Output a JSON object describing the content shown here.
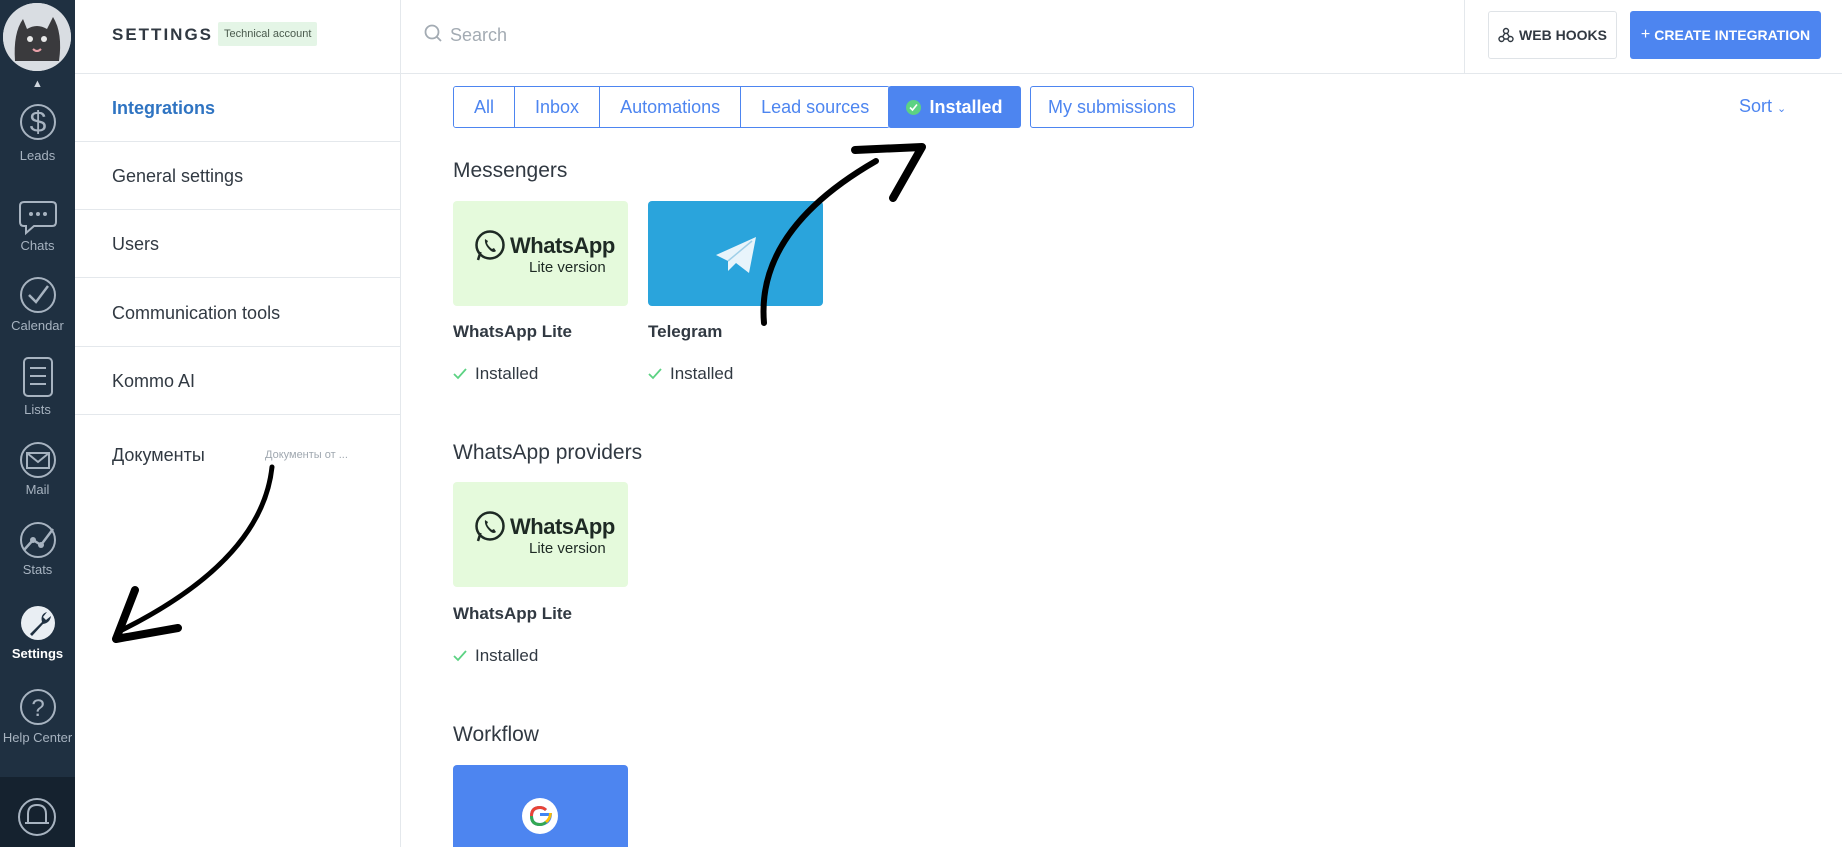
{
  "rail": {
    "items": [
      {
        "label": "Leads",
        "icon": "dollar-icon"
      },
      {
        "label": "Chats",
        "icon": "chat-bubble-icon"
      },
      {
        "label": "Calendar",
        "icon": "check-circle-icon"
      },
      {
        "label": "Lists",
        "icon": "list-icon"
      },
      {
        "label": "Mail",
        "icon": "mail-icon"
      },
      {
        "label": "Stats",
        "icon": "stats-icon"
      },
      {
        "label": "Settings",
        "icon": "wrench-icon",
        "active": true
      },
      {
        "label": "Help Center",
        "icon": "question-icon"
      }
    ]
  },
  "menu": {
    "title": "SETTINGS",
    "account_badge": "Technical account",
    "items": [
      {
        "label": "Integrations",
        "active": true
      },
      {
        "label": "General settings"
      },
      {
        "label": "Users"
      },
      {
        "label": "Communication tools"
      },
      {
        "label": "Kommo AI"
      },
      {
        "label": "Документы",
        "sub": "Документы от ..."
      }
    ]
  },
  "topbar": {
    "search_placeholder": "Search",
    "webhooks_label": "WEB HOOKS",
    "create_label": "CREATE INTEGRATION",
    "create_prefix": "+"
  },
  "filters": {
    "tabs": [
      "All",
      "Inbox",
      "Automations",
      "Lead sources"
    ],
    "installed": "Installed",
    "submissions": "My submissions",
    "sort": "Sort"
  },
  "sections": [
    {
      "title": "Messengers",
      "cards": [
        {
          "name": "WhatsApp Lite",
          "status": "Installed",
          "logo_word": "WhatsApp",
          "logo_sub": "Lite version"
        },
        {
          "name": "Telegram",
          "status": "Installed"
        }
      ]
    },
    {
      "title": "WhatsApp providers",
      "cards": [
        {
          "name": "WhatsApp Lite",
          "status": "Installed",
          "logo_word": "WhatsApp",
          "logo_sub": "Lite version"
        }
      ]
    },
    {
      "title": "Workflow",
      "cards": []
    }
  ],
  "colors": {
    "rail_bg": "#1f3041",
    "accent": "#4d85f0",
    "installed_check": "#5cd283",
    "whatsapp_card": "#e5fadc",
    "telegram_card": "#2aa4dc"
  }
}
